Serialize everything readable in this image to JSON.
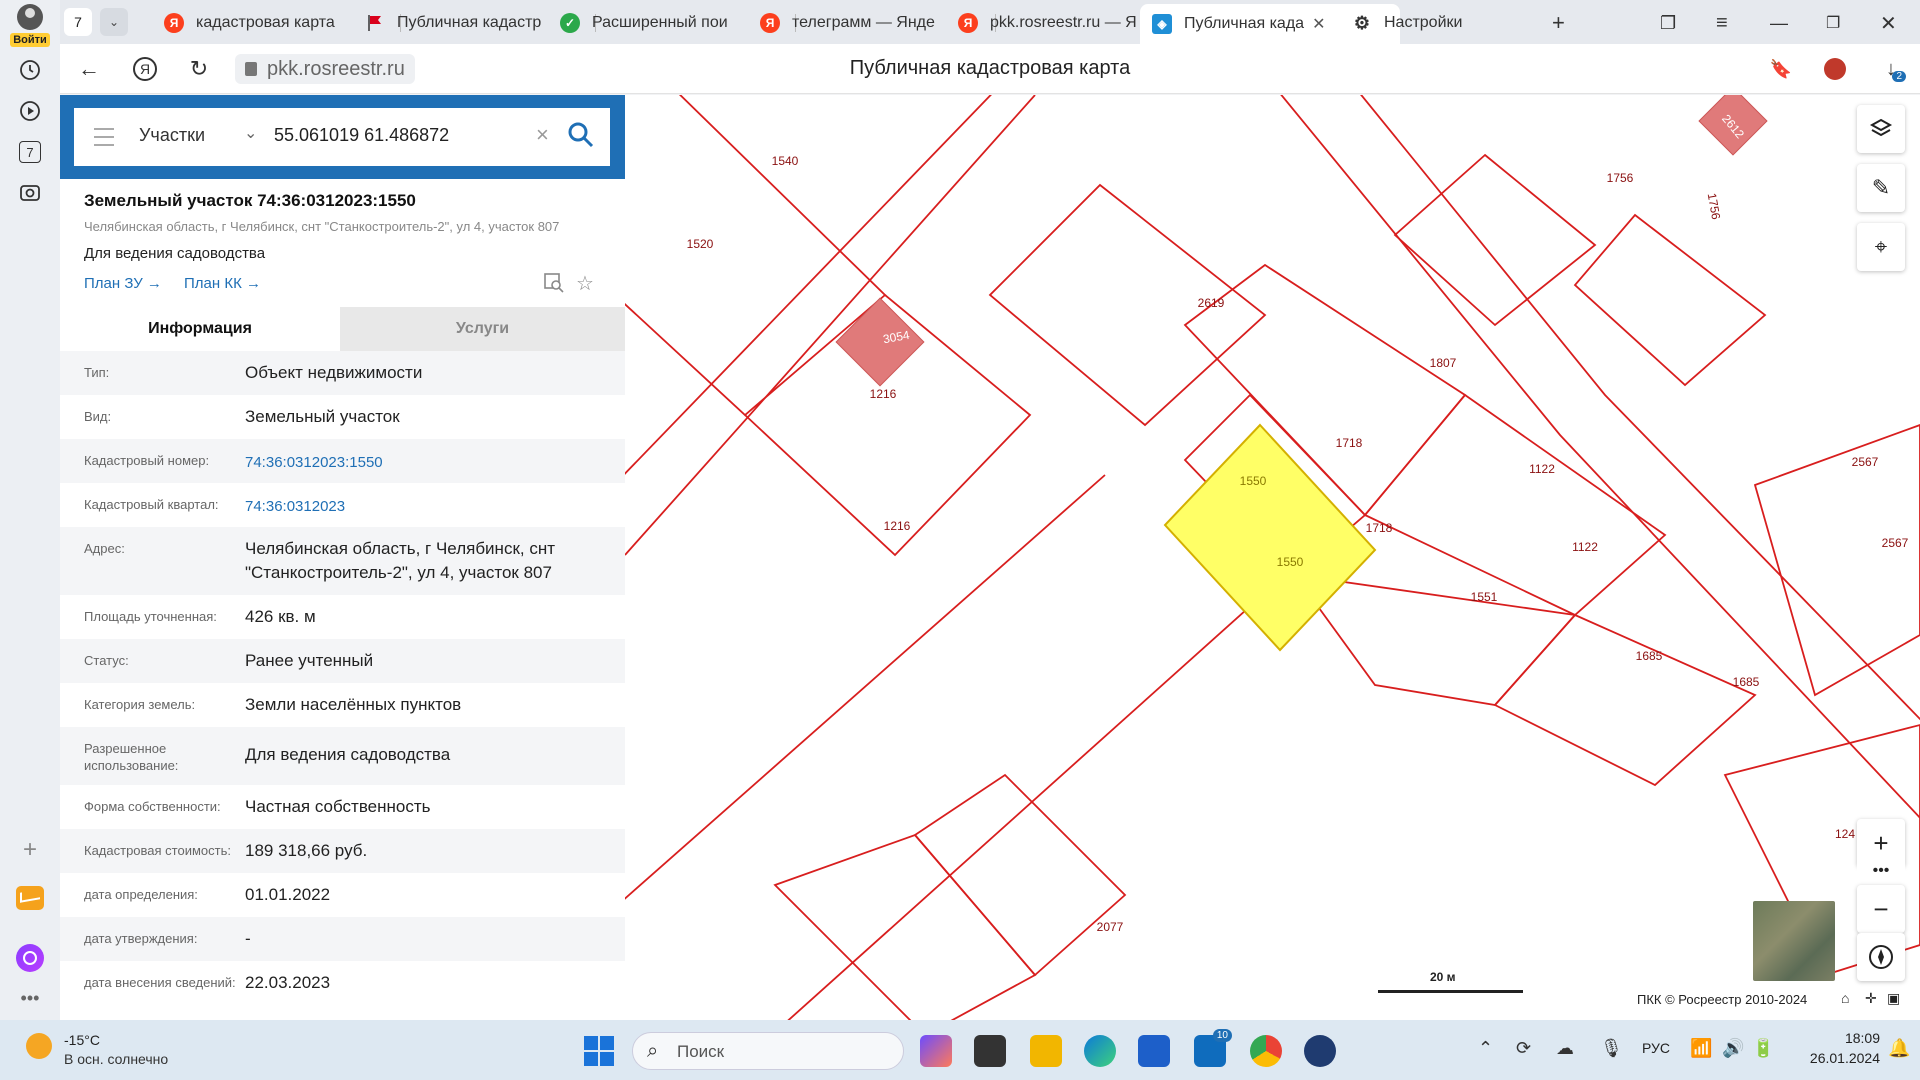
{
  "browser": {
    "login_label": "Войти",
    "tab_count": "7",
    "tabs": [
      {
        "title": "кадастровая карта",
        "icon_color": "#fc3f1d"
      },
      {
        "title": "Публичная кадастр",
        "icon_color": "#d9001b"
      },
      {
        "title": "Расширенный пои",
        "icon_color": "#2ba84a"
      },
      {
        "title": "телеграмм — Янде",
        "icon_color": "#fc3f1d"
      },
      {
        "title": "pkk.rosreestr.ru — Я",
        "icon_color": "#fc3f1d"
      },
      {
        "title": "Публичная када",
        "icon_color": "#1f8fd6"
      },
      {
        "title": "Настройки",
        "icon_color": "#333333"
      }
    ],
    "url": "pkk.rosreestr.ru",
    "page_title": "Публичная кадастровая карта",
    "downloads_badge": "2",
    "rail_badge": "7"
  },
  "search": {
    "type_label": "Участки",
    "query": "55.061019 61.486872"
  },
  "parcel": {
    "title": "Земельный участок 74:36:0312023:1550",
    "address_small": "Челябинская область, г Челябинск, снт \"Станкостроитель-2\", ул 4, участок 807",
    "usage": "Для ведения садоводства",
    "link_plan_zu": "План ЗУ →",
    "link_plan_kk": "План КК →",
    "tab_info": "Информация",
    "tab_services": "Услуги",
    "rows": [
      {
        "k": "Тип:",
        "v": "Объект недвижимости"
      },
      {
        "k": "Вид:",
        "v": "Земельный участок"
      },
      {
        "k": "Кадастровый номер:",
        "v": "74:36:0312023:1550",
        "link": true
      },
      {
        "k": "Кадастровый квартал:",
        "v": "74:36:0312023",
        "link": true
      },
      {
        "k": "Адрес:",
        "v": "Челябинская область, г Челябинск, снт \"Станкостроитель-2\", ул 4, участок 807"
      },
      {
        "k": "Площадь уточненная:",
        "v": "426 кв. м"
      },
      {
        "k": "Статус:",
        "v": "Ранее учтенный"
      },
      {
        "k": "Категория земель:",
        "v": "Земли населённых пунктов"
      },
      {
        "k": "Разрешенное использование:",
        "v": "Для ведения садоводства"
      },
      {
        "k": "Форма собственности:",
        "v": "Частная собственность"
      },
      {
        "k": "Кадастровая стоимость:",
        "v": "189 318,66 руб."
      },
      {
        "k": "дата определения:",
        "v": "01.01.2022"
      },
      {
        "k": "дата утверждения:",
        "v": "-"
      },
      {
        "k": "дата внесения сведений:",
        "v": "22.03.2023"
      }
    ]
  },
  "map": {
    "labels": [
      "1540",
      "1520",
      "3054",
      "1216",
      "1216",
      "2619",
      "2612",
      "1756",
      "1756",
      "1807",
      "1718",
      "1718",
      "1550",
      "1550",
      "1122",
      "1122",
      "1551",
      "2567",
      "2567",
      "1685",
      "1685",
      "2077",
      "124"
    ],
    "scale_label": "20 м",
    "copyright": "ПКК © Росреестр 2010-2024",
    "parcel_color": "#ffff66",
    "boundary_color": "#d81e1e"
  },
  "taskbar": {
    "temp": "-15°C",
    "weather_desc": "В осн. солнечно",
    "search_placeholder": "Поиск",
    "mail_badge": "10",
    "lang": "РУС",
    "time": "18:09",
    "date": "26.01.2024"
  }
}
